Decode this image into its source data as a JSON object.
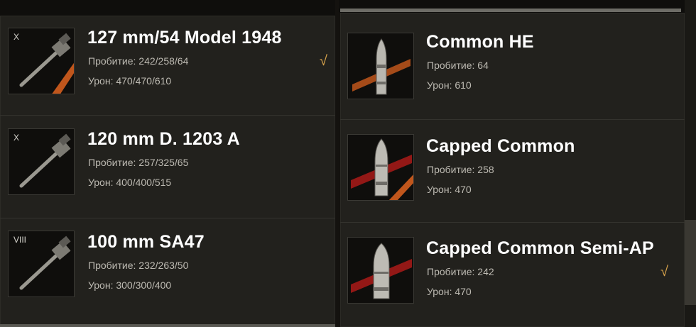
{
  "guns": [
    {
      "tier": "X",
      "name": "127 mm/54 Model 1948",
      "penetration_label": "Пробитие:",
      "penetration": "242/258/64",
      "damage_label": "Урон:",
      "damage": "470/470/610",
      "selected": true
    },
    {
      "tier": "X",
      "name": "120 mm D. 1203 A",
      "penetration_label": "Пробитие:",
      "penetration": "257/325/65",
      "damage_label": "Урон:",
      "damage": "400/400/515",
      "selected": false
    },
    {
      "tier": "VIII",
      "name": "100 mm SA47",
      "penetration_label": "Пробитие:",
      "penetration": "232/263/50",
      "damage_label": "Урон:",
      "damage": "300/300/400",
      "selected": false
    }
  ],
  "shells": [
    {
      "name": "Common HE",
      "penetration_label": "Пробитие:",
      "penetration": "64",
      "damage_label": "Урон:",
      "damage": "610",
      "selected": false,
      "icon": "he-shell-icon"
    },
    {
      "name": "Capped Common",
      "penetration_label": "Пробитие:",
      "penetration": "258",
      "damage_label": "Урон:",
      "damage": "470",
      "selected": false,
      "icon": "ap-shell-icon"
    },
    {
      "name": "Capped Common Semi-AP",
      "penetration_label": "Пробитие:",
      "penetration": "242",
      "damage_label": "Урон:",
      "damage": "470",
      "selected": true,
      "icon": "sap-shell-icon"
    }
  ],
  "check_glyph": "√",
  "colors": {
    "accent": "#d6a24b",
    "stripe_orange": "#c0561c",
    "stripe_red": "#a21a17"
  }
}
